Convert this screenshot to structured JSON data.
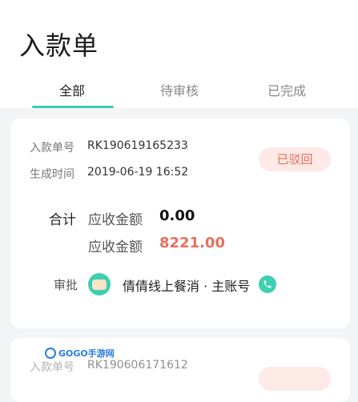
{
  "header": {
    "title": "入款单"
  },
  "tabs": [
    {
      "label": "全部",
      "active": true
    },
    {
      "label": "待审核",
      "active": false
    },
    {
      "label": "已完成",
      "active": false
    }
  ],
  "colors": {
    "accent": "#3dcfb0",
    "rejected": "#e8705e",
    "rejected_bg": "#fde9e6"
  },
  "cards": [
    {
      "order_no_label": "入款单号",
      "order_no": "RK190619165233",
      "created_label": "生成时间",
      "created": "2019-06-19 16:52",
      "status": "已驳回",
      "total_label": "合计",
      "receivable_label": "应收金额",
      "receivable_value": "0.00",
      "receivable2_label": "应收金额",
      "receivable2_value": "8221.00",
      "approve_label": "审批",
      "approver": "倩倩线上餐消 · 主账号",
      "approver_icon": "avatar-icon",
      "contact_icon": "phone-icon"
    },
    {
      "order_no_label": "入款单号",
      "order_no": "RK190606171612"
    }
  ],
  "watermark": {
    "text": "GOGO手游网"
  }
}
